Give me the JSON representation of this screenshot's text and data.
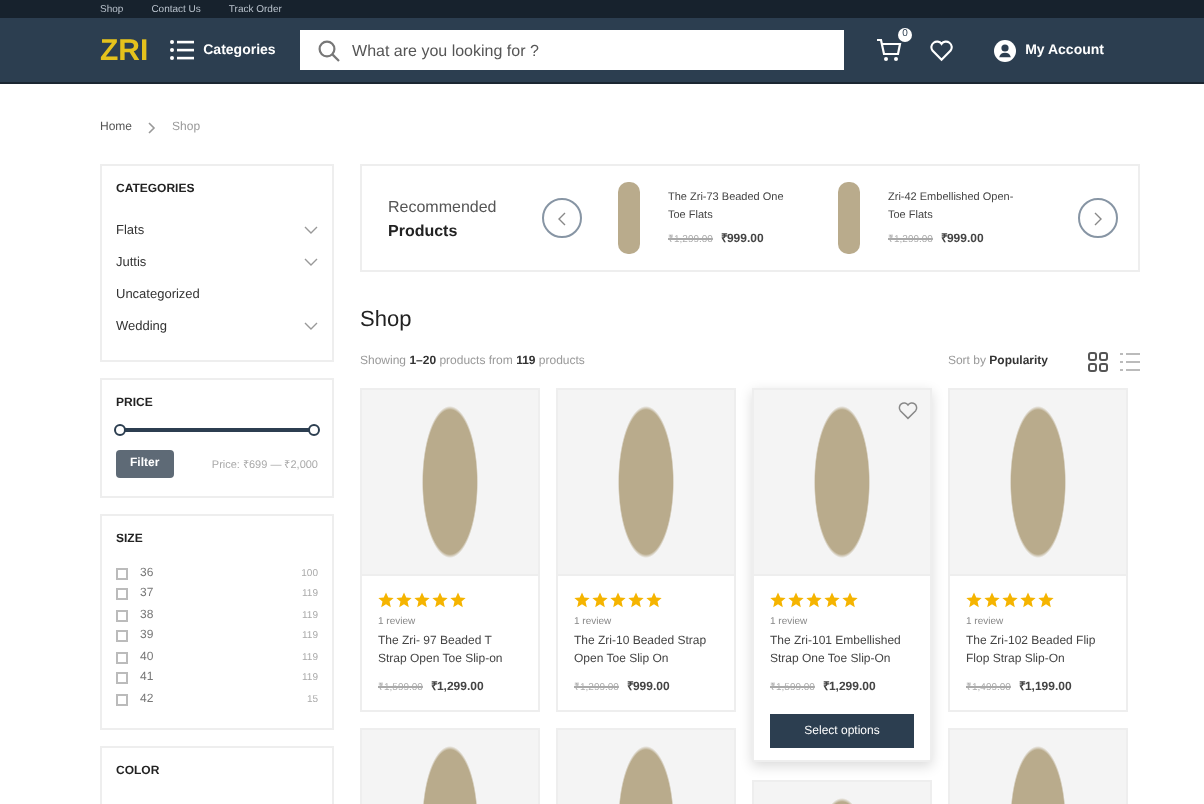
{
  "top_links": [
    "Shop",
    "Contact Us",
    "Track Order"
  ],
  "header": {
    "logo": "ZRI",
    "categories": "Categories",
    "search_placeholder": "What are you looking for ?",
    "cart_count": "0",
    "account": "My Account"
  },
  "breadcrumb": [
    "Home",
    "Shop"
  ],
  "sidebar": {
    "categories": {
      "title": "CATEGORIES",
      "items": [
        {
          "label": "Flats",
          "expandable": true
        },
        {
          "label": "Juttis",
          "expandable": true
        },
        {
          "label": "Uncategorized",
          "expandable": false
        },
        {
          "label": "Wedding",
          "expandable": true
        }
      ]
    },
    "price": {
      "title": "PRICE",
      "level": 1,
      "button": "Filter",
      "range": "Price: ₹699 — ₹2,000"
    },
    "size": {
      "title": "SIZE",
      "items": [
        {
          "label": "36",
          "count": "100",
          "checked": false
        },
        {
          "label": "37",
          "count": "119",
          "checked": false
        },
        {
          "label": "38",
          "count": "119",
          "checked": false
        },
        {
          "label": "39",
          "count": "119",
          "checked": false
        },
        {
          "label": "40",
          "count": "119",
          "checked": false
        },
        {
          "label": "41",
          "count": "119",
          "checked": false
        },
        {
          "label": "42",
          "count": "15",
          "checked": false
        }
      ]
    },
    "color": {
      "title": "COLOR"
    }
  },
  "recommended": {
    "title_light": "Recommended",
    "title_bold": "Products",
    "items": [
      {
        "name": "The Zri-73 Beaded One Toe Flats",
        "old_price": "₹1,299.00",
        "price": "₹999.00"
      },
      {
        "name": "Zri-42 Embellished Open-Toe Flats",
        "old_price": "₹1,299.00",
        "price": "₹999.00"
      }
    ]
  },
  "shop": {
    "title": "Shop",
    "showing": "Showing **1–20** products from **119** products",
    "sort_label": "Sort by",
    "sort_value": "Popularity",
    "views": [
      {
        "kind": "grid",
        "selected": true
      },
      {
        "kind": "list",
        "selected": false
      }
    ]
  },
  "products": [
    {
      "stars": 5,
      "reviews": "1 review",
      "name": "The Zri- 97 Beaded T Strap Open Toe Slip-on",
      "old_price": "₹1,599.00",
      "price": "₹1,299.00",
      "hovered": false
    },
    {
      "stars": 5,
      "reviews": "1 review",
      "name": "The Zri-10 Beaded Strap Open Toe Slip On",
      "old_price": "₹1,299.00",
      "price": "₹999.00",
      "hovered": false
    },
    {
      "stars": 5,
      "reviews": "1 review",
      "name": "The Zri-101 Embellished Strap One Toe Slip-On",
      "old_price": "₹1,599.00",
      "price": "₹1,299.00",
      "hovered": true
    },
    {
      "stars": 5,
      "reviews": "1 review",
      "name": "The Zri-102 Beaded Flip Flop Strap Slip-On",
      "old_price": "₹1,499.00",
      "price": "₹1,199.00",
      "hovered": false
    }
  ],
  "select_button": "Select options"
}
